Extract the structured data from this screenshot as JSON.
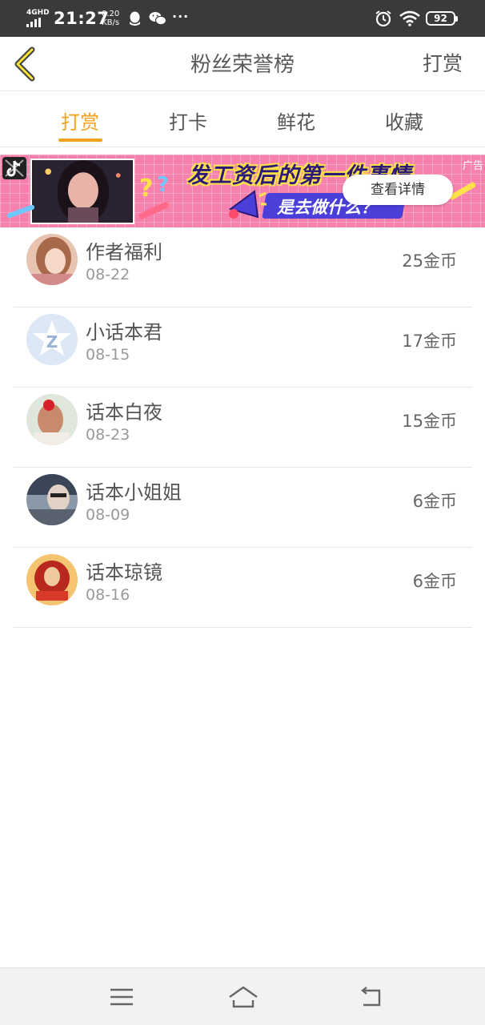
{
  "status_bar": {
    "network": "4GHD",
    "time": "21:27",
    "speed_value": "0.20",
    "speed_unit": "KB/s",
    "more": "···",
    "battery": "92",
    "icons": [
      "qq-icon",
      "wechat-icon",
      "alarm-icon",
      "wifi-icon",
      "battery-icon"
    ]
  },
  "header": {
    "title": "粉丝荣誉榜",
    "action_label": "打赏",
    "back_icon": "chevron-left-icon",
    "accent_color": "#f3a21a"
  },
  "tabs": [
    {
      "label": "打赏",
      "active": true
    },
    {
      "label": "打卡",
      "active": false
    },
    {
      "label": "鲜花",
      "active": false
    },
    {
      "label": "收藏",
      "active": false
    }
  ],
  "ad": {
    "headline": "发工资后的第一件事情",
    "subline": "是去做什么？",
    "cta": "查看详情",
    "label": "广告"
  },
  "fans": [
    {
      "name": "作者福利",
      "date": "08-22",
      "amount": "25金币"
    },
    {
      "name": "小话本君",
      "date": "08-15",
      "amount": "17金币"
    },
    {
      "name": "话本白夜",
      "date": "08-23",
      "amount": "15金币"
    },
    {
      "name": "话本小姐姐",
      "date": "08-09",
      "amount": "6金币"
    },
    {
      "name": "话本琼镜",
      "date": "08-16",
      "amount": "6金币"
    }
  ],
  "navbar": {
    "icons": [
      "menu-icon",
      "home-icon",
      "back-icon"
    ]
  }
}
